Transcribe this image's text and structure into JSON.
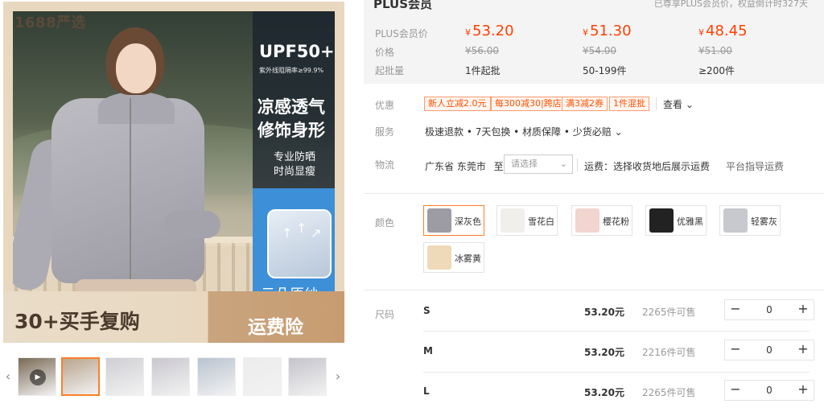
{
  "gallery": {
    "brand_badge": "1688严选",
    "upf_title": "UPF50+",
    "upf_subtitle": "紫外线阻隔率≥99.9%",
    "cool_line_1": "凉感透气",
    "cool_line_2": "修饰身形",
    "pro_line_1": "专业防晒",
    "pro_line_2": "时尚显瘦",
    "cloud_label": "云朵原纱",
    "repurchase": "30+买手复购",
    "shipping_insurance": "运费险",
    "prev_arrow": "‹",
    "next_arrow": "›",
    "thumbnails": [
      {
        "color": "#7a6a55",
        "video": true,
        "play": "▶"
      },
      {
        "color": "#b8a58f",
        "active": true
      },
      {
        "color": "#cfcfd4"
      },
      {
        "color": "#c9c7ce"
      },
      {
        "color": "#b9c3cf"
      },
      {
        "color": "#ececec"
      },
      {
        "color": "#c5c4cb"
      }
    ]
  },
  "price": {
    "plus_title": "PLUS会员",
    "plus_note": "已尊享PLUS会员价，权益倒计时327天",
    "label_plus_price": "PLUS会员价",
    "label_price": "价格",
    "label_batch": "起批量",
    "currency": "¥",
    "tiers": [
      {
        "plus_price": "53.20",
        "price": "¥56.00",
        "batch": "1件起批"
      },
      {
        "plus_price": "51.30",
        "price": "¥54.00",
        "batch": "50-199件"
      },
      {
        "plus_price": "48.45",
        "price": "¥51.00",
        "batch": "≥200件"
      }
    ]
  },
  "offers": {
    "label": "优惠",
    "tags": [
      "新人立减2.0元",
      "每300减30|跨店",
      "满3减2券",
      "1件混批"
    ],
    "see_more": "查看 ⌄"
  },
  "service": {
    "label": "服务",
    "text": "极速退款 • 7天包换 • 材质保障 • 少货必赔 ⌄"
  },
  "logistics": {
    "label": "物流",
    "origin": "广东省 东莞市",
    "to": "至",
    "select_placeholder": "请选择",
    "select_arrow": "⌄",
    "shipping_text": "运费：选择收货地后展示运费",
    "guide_link": "平台指导运费"
  },
  "colors": {
    "label": "颜色",
    "options": [
      {
        "name": "深灰色",
        "swatch": "#9d9ca4",
        "selected": true
      },
      {
        "name": "雪花白",
        "swatch": "#f1efec"
      },
      {
        "name": "樱花粉",
        "swatch": "#f2d5cf"
      },
      {
        "name": "优雅黑",
        "swatch": "#222222"
      },
      {
        "name": "轻雾灰",
        "swatch": "#c8c8cf"
      },
      {
        "name": "冰雾黄",
        "swatch": "#eed9b8"
      }
    ]
  },
  "sizes": {
    "label": "尺码",
    "rows": [
      {
        "size": "S",
        "price": "53.20元",
        "stock": "2265件可售",
        "qty": "0"
      },
      {
        "size": "M",
        "price": "53.20元",
        "stock": "2216件可售",
        "qty": "0"
      },
      {
        "size": "L",
        "price": "53.20元",
        "stock": "2265件可售",
        "qty": "0"
      }
    ],
    "minus": "−",
    "plus": "+"
  }
}
